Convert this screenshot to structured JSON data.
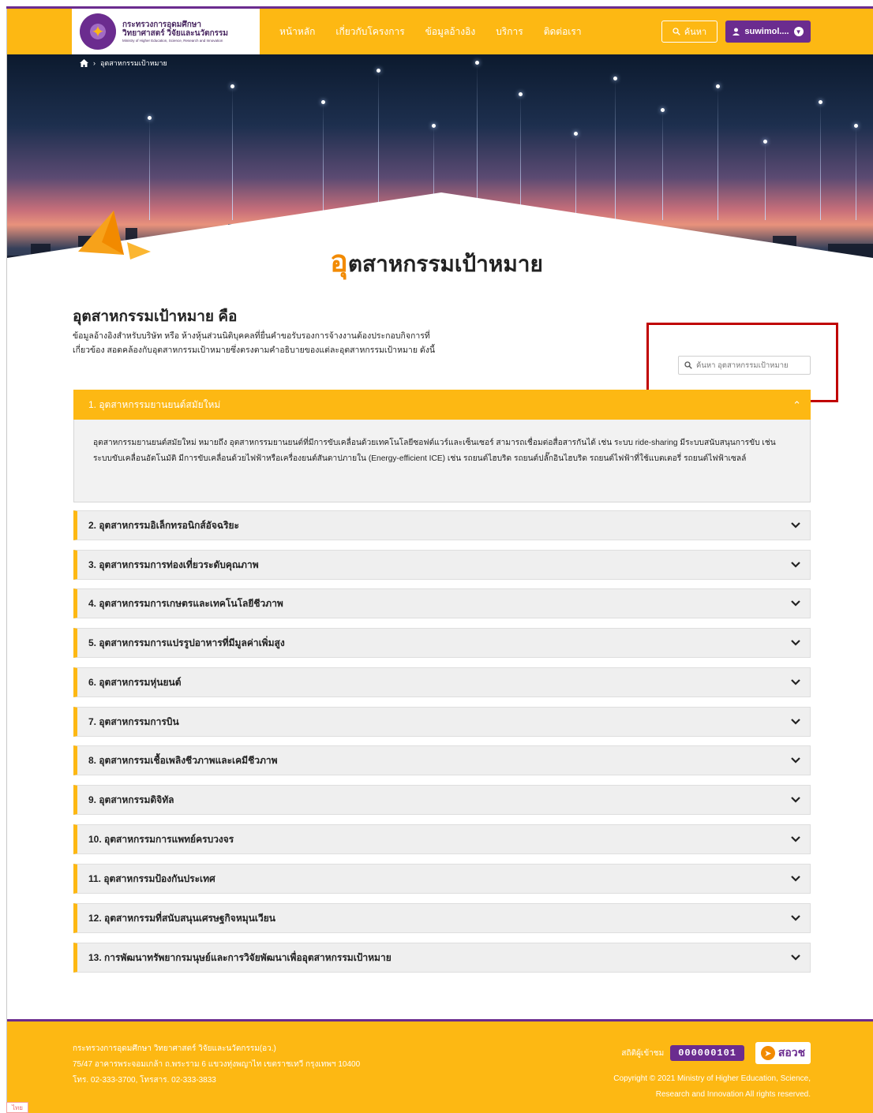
{
  "header": {
    "logo": {
      "line1": "กระทรวงการอุดมศึกษา",
      "line2": "วิทยาศาสตร์ วิจัยและนวัตกรรม",
      "line3": "Ministry of Higher Education, Science, Research and Innovation"
    },
    "nav": [
      "หน้าหลัก",
      "เกี่ยวกับโครงการ",
      "ข้อมูลอ้างอิง",
      "บริการ",
      "ติดต่อเรา"
    ],
    "search_label": "ค้นหา",
    "user_label": "suwimol....",
    "colors": {
      "primary": "#fdb813",
      "accent": "#6b2c8f"
    }
  },
  "breadcrumb": {
    "current": "อุตสาหกรรมเป้าหมาย"
  },
  "page_title": {
    "first_letter": "อุ",
    "rest": "ตสาหกรรมเป้าหมาย"
  },
  "intro": {
    "heading": "อุตสาหกรรมเป้าหมาย คือ",
    "text": "ข้อมูลอ้างอิงสำหรับบริษัท หรือ ห้างหุ้นส่วนนิติบุคคลที่ยื่นคำขอรับรองการจ้างงานต้องประกอบกิจการที่ เกี่ยวข้อง สอดคล้องกับอุตสาหกรรมเป้าหมายซึ่งตรงตามคำอธิบายของแต่ละอุตสาหกรรมเป้าหมาย ดังนี้"
  },
  "filter": {
    "placeholder": "ค้นหา อุตสาหกรรมเป้าหมาย"
  },
  "accordion": {
    "open": {
      "title": "1. อุตสาหกรรมยานยนต์สมัยใหม่",
      "body": "อุตสาหกรรมยานยนต์สมัยใหม่ หมายถึง อุตสาหกรรมยานยนต์ที่มีการขับเคลื่อนด้วยเทคโนโลยีซอฟต์แวร์และเซ็นเซอร์ สามารถเชื่อมต่อสื่อสารกันได้ เช่น ระบบ ride-sharing มีระบบสนับสนุนการขับ เช่น ระบบขับเคลื่อนอัตโนมัติ มีการขับเคลื่อนด้วยไฟฟ้าหรือเครื่องยนต์สันดาปภายใน (Energy-efficient ICE) เช่น รถยนต์ไฮบริด รถยนต์ปลั๊กอินไฮบริด รถยนต์ไฟฟ้าที่ใช้แบตเตอรี่ รถยนต์ไฟฟ้าเซลล์"
    },
    "items": [
      "2. อุตสาหกรรมอิเล็กทรอนิกส์อัจฉริยะ",
      "3. อุตสาหกรรมการท่องเที่ยวระดับคุณภาพ",
      "4. อุตสาหกรรมการเกษตรและเทคโนโลยีชีวภาพ",
      "5. อุตสาหกรรมการแปรรูปอาหารที่มีมูลค่าเพิ่มสูง",
      "6. อุตสาหกรรมหุ่นยนต์",
      "7. อุตสาหกรรมการบิน",
      "8. อุตสาหกรรมเชื้อเพลิงชีวภาพและเคมีชีวภาพ",
      "9. อุตสาหกรรมดิจิทัล",
      "10. อุตสาหกรรมการแพทย์ครบวงจร",
      "11. อุตสาหกรรมป้องกันประเทศ",
      "12. อุตสาหกรรมที่สนับสนุนเศรษฐกิจหมุนเวียน",
      "13. การพัฒนาทรัพยากรมนุษย์และการวิจัยพัฒนาเพื่ออุตสาหกรรมเป้าหมาย"
    ]
  },
  "footer": {
    "org": "กระทรวงการอุดมศึกษา วิทยาศาสตร์ วิจัยและนวัตกรรม(อว.)",
    "address": "75/47 อาคารพระจอมเกล้า ถ.พระราม 6 แขวงทุ่งพญาไท เขตราชเทวี กรุงเทพฯ 10400",
    "phone": "โทร. 02-333-3700, โทรสาร. 02-333-3833",
    "stats_label": "สถิติผู้เข้าชม",
    "counter": "000000101",
    "saw_label": "สอวช",
    "copyright_line1": "Copyright © 2021 Ministry of Higher Education, Science,",
    "copyright_line2": "Research and Innovation All rights reserved."
  },
  "corner_tag": "ไทย"
}
